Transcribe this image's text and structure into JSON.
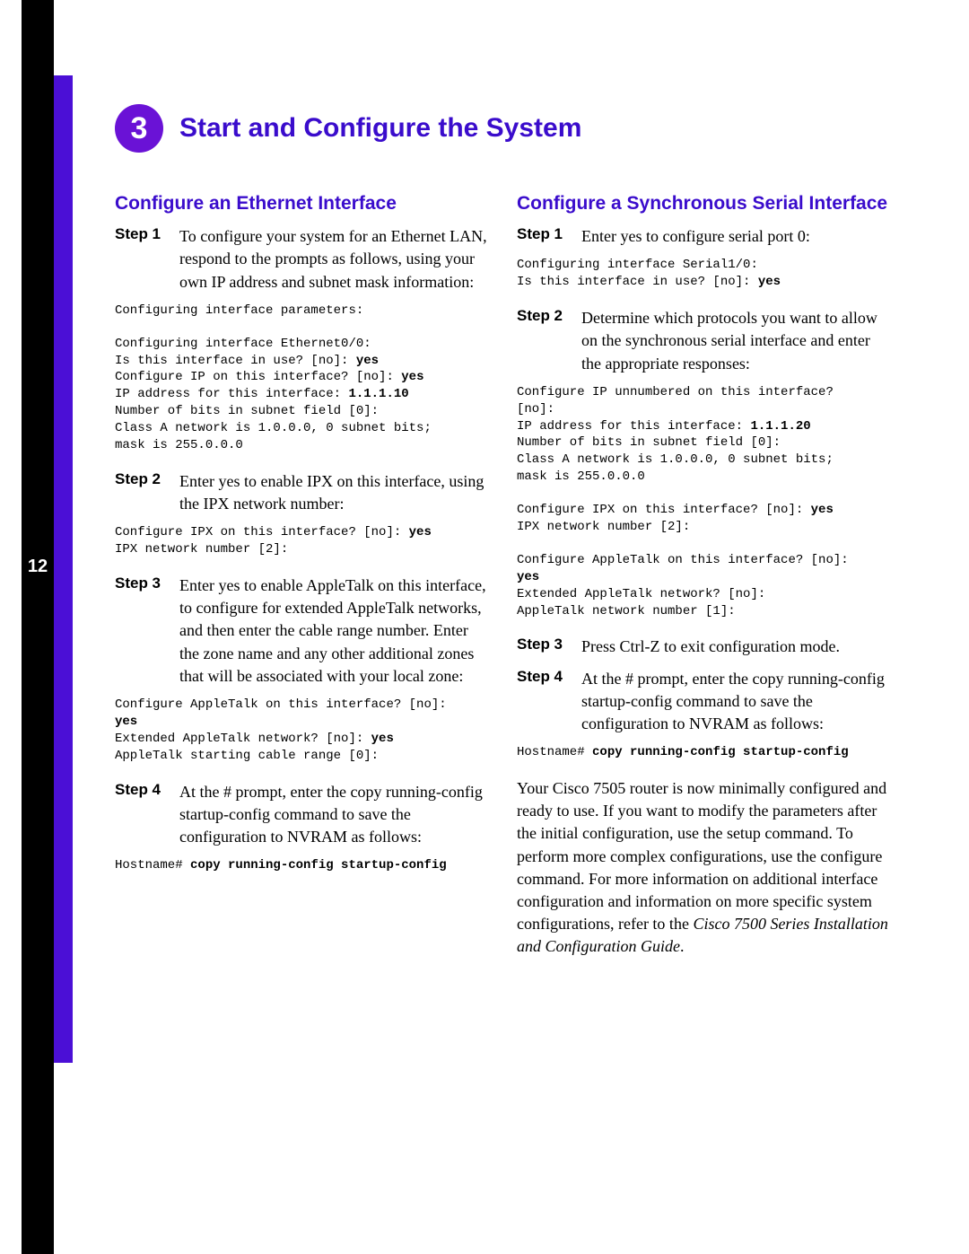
{
  "page_number": "12",
  "section": {
    "badge": "3",
    "title": "Start and Configure the System"
  },
  "left": {
    "heading": "Configure an Ethernet Interface",
    "steps": {
      "s1": {
        "label": "Step 1",
        "body": "To configure your system for an Ethernet LAN, respond to the prompts as follows, using your own IP address and subnet mask information:"
      },
      "s2": {
        "label": "Step 2",
        "body": "Enter yes to enable IPX on this interface, using the IPX network number:"
      },
      "s3": {
        "label": "Step 3",
        "body": "Enter yes to enable AppleTalk on this interface, to configure for extended AppleTalk networks, and then enter the cable range number. Enter the zone name and any other additional zones that will be associated with your local zone:"
      },
      "s4": {
        "label": "Step 4",
        "body": "At the # prompt, enter the copy running-config startup-config command to save the configuration to NVRAM as follows:"
      }
    },
    "code": {
      "c1a": "Configuring interface parameters:",
      "c1b_pre": "Configuring interface Ethernet0/0:\nIs this interface in use? [no]: ",
      "c1b_b1": "yes",
      "c1b_mid1": "\nConfigure IP on this interface? [no]: ",
      "c1b_b2": "yes",
      "c1b_mid2": "\nIP address for this interface: ",
      "c1b_b3": "1.1.1.10",
      "c1b_post": "\nNumber of bits in subnet field [0]:\nClass A network is 1.0.0.0, 0 subnet bits;\nmask is 255.0.0.0",
      "c2_pre": "Configure IPX on this interface? [no]: ",
      "c2_b": "yes",
      "c2_post": "\nIPX network number [2]:",
      "c3_pre": "Configure AppleTalk on this interface? [no]:\n",
      "c3_b1": "yes",
      "c3_mid": "\nExtended AppleTalk network? [no]: ",
      "c3_b2": "yes",
      "c3_post": "\nAppleTalk starting cable range [0]:",
      "c4_pre": "Hostname# ",
      "c4_b": "copy running-config startup-config"
    }
  },
  "right": {
    "heading": "Configure a Synchronous Serial Interface",
    "steps": {
      "s1": {
        "label": "Step 1",
        "body": "Enter yes to configure serial port 0:"
      },
      "s2": {
        "label": "Step 2",
        "body": "Determine which protocols you want to allow on the synchronous serial interface and enter the appropriate responses:"
      },
      "s3": {
        "label": "Step 3",
        "body": "Press Ctrl-Z to exit configuration mode."
      },
      "s4": {
        "label": "Step 4",
        "body": "At the # prompt, enter the copy running-config startup-config command to save the configuration to NVRAM as follows:"
      }
    },
    "code": {
      "c1_pre": "Configuring interface Serial1/0:\nIs this interface in use? [no]: ",
      "c1_b": "yes",
      "c2a_pre": "Configure IP unnumbered on this interface?\n[no]:\nIP address for this interface: ",
      "c2a_b": "1.1.1.20",
      "c2a_post": "\nNumber of bits in subnet field [0]:\nClass A network is 1.0.0.0, 0 subnet bits;\nmask is 255.0.0.0",
      "c2b_pre": "Configure IPX on this interface? [no]: ",
      "c2b_b": "yes",
      "c2b_post": "\nIPX network number [2]:",
      "c2c_pre": "Configure AppleTalk on this interface? [no]:\n",
      "c2c_b": "yes",
      "c2c_post": "\nExtended AppleTalk network? [no]:\nAppleTalk network number [1]:",
      "c4_pre": "Hostname# ",
      "c4_b": "copy running-config startup-config"
    },
    "closing_pre": "Your Cisco 7505 router is now minimally configured and ready to use. If you want to modify the parameters after the initial configuration, use the setup command. To perform more complex configurations, use the configure command. For more information on additional interface configuration and information on more specific system configurations, refer to the ",
    "closing_italic": "Cisco 7500 Series Installation and Configuration Guide",
    "closing_post": "."
  }
}
